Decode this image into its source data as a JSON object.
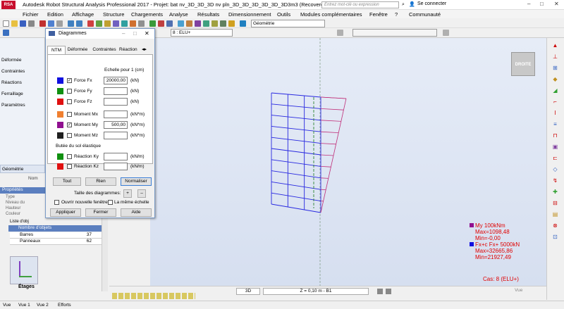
{
  "app": {
    "title": "Autodesk Robot Structural Analysis Professional 2017 - Projet: bat nv_3D_3D_3D nv pln_3D_3D_3D_3D_3D_3D3m3 (Recovered) ReDone...",
    "logo": "RSA PRO",
    "search_placeholder": "Entrez mot-clé ou expression",
    "signin": "Se connecter"
  },
  "menu": [
    "Fichier",
    "Edition",
    "Affichage",
    "Structure",
    "Chargements",
    "Analyse",
    "Résultats",
    "Dimensionnement",
    "Outils",
    "Modules complémentaires",
    "Fenêtre",
    "?",
    "Communauté"
  ],
  "toolbar": {
    "case_combo": "8 : ELU+",
    "view_combo": "Géométrie"
  },
  "left_panel": {
    "items": [
      "Déformée",
      "Contraintes",
      "Réactions",
      "Ferraillage",
      "Paramètres"
    ],
    "geom_tab": "Géométrie",
    "geom_name": "Nom",
    "props_header": "Propriétés",
    "props_rows": [
      "Type",
      "Niveau du",
      "Hauteur",
      "Couleur"
    ],
    "list_id": "Liste d'obj",
    "objects_header": "Nombre d'objets",
    "objects": [
      {
        "name": "Barres",
        "count": "37"
      },
      {
        "name": "Panneaux",
        "count": "62"
      }
    ],
    "etages": "Étages"
  },
  "dialog": {
    "title": "Diagrammes",
    "tabs": [
      "NTM",
      "Déformée",
      "Contraintes",
      "Réaction"
    ],
    "scale_label": "Echelle pour 1  (cm)",
    "rows": [
      {
        "color": "#1010e0",
        "checked": true,
        "label": "Force Fx",
        "value": "20000,00",
        "unit": "(kN)"
      },
      {
        "color": "#109010",
        "checked": false,
        "label": "Force Fy",
        "value": "",
        "unit": "(kN)"
      },
      {
        "color": "#e01010",
        "checked": false,
        "label": "Force Fz",
        "value": "",
        "unit": "(kN)"
      },
      {
        "color": "#f08030",
        "checked": false,
        "label": "Moment Mx",
        "value": "",
        "unit": "(kN*m)"
      },
      {
        "color": "#901090",
        "checked": true,
        "label": "Moment My",
        "value": "500,00",
        "unit": "(kN*m)"
      },
      {
        "color": "#202020",
        "checked": false,
        "label": "Moment Mz",
        "value": "",
        "unit": "(kN*m)"
      }
    ],
    "elastic_label": "Butée du sol élastique",
    "elastic_rows": [
      {
        "color": "#109010",
        "checked": false,
        "label": "Réaction Ky",
        "value": "",
        "unit": "(kN/m)"
      },
      {
        "color": "#e01010",
        "checked": false,
        "label": "Réaction Kz",
        "value": "",
        "unit": "(kN/m)"
      }
    ],
    "btn_tout": "Tout",
    "btn_rien": "Rien",
    "btn_normaliser": "Normaliser",
    "size_label": "Taille des diagrammes:",
    "btn_plus": "+",
    "btn_minus": "–",
    "opt_new_window": "Ouvrir nouvelle fenêtre",
    "opt_same_scale": "La même échelle",
    "btn_apply": "Appliquer",
    "btn_close": "Fermer",
    "btn_help": "Aide"
  },
  "viewport": {
    "viewcube": "DROITE",
    "legend_my": [
      "My  100kNm",
      "Max=1098,48",
      "Min=-0,00"
    ],
    "legend_fx": [
      "Fx+c Fx+  5000kN",
      "Max=32665,86",
      "Min=21927,49"
    ],
    "cas": "Cas: 8 (ELU+)",
    "mode": "3D",
    "zcoord": "Z = 0,10 m - B1",
    "vue": "Vue"
  },
  "status": {
    "items": [
      "Vue",
      "Vue 1",
      "Vue 2",
      "Efforts"
    ]
  },
  "colors": {
    "structure": "#2828e0",
    "diagram": "#c0307a",
    "axis": "#1a7a1a",
    "legend_red": "#e00000"
  }
}
